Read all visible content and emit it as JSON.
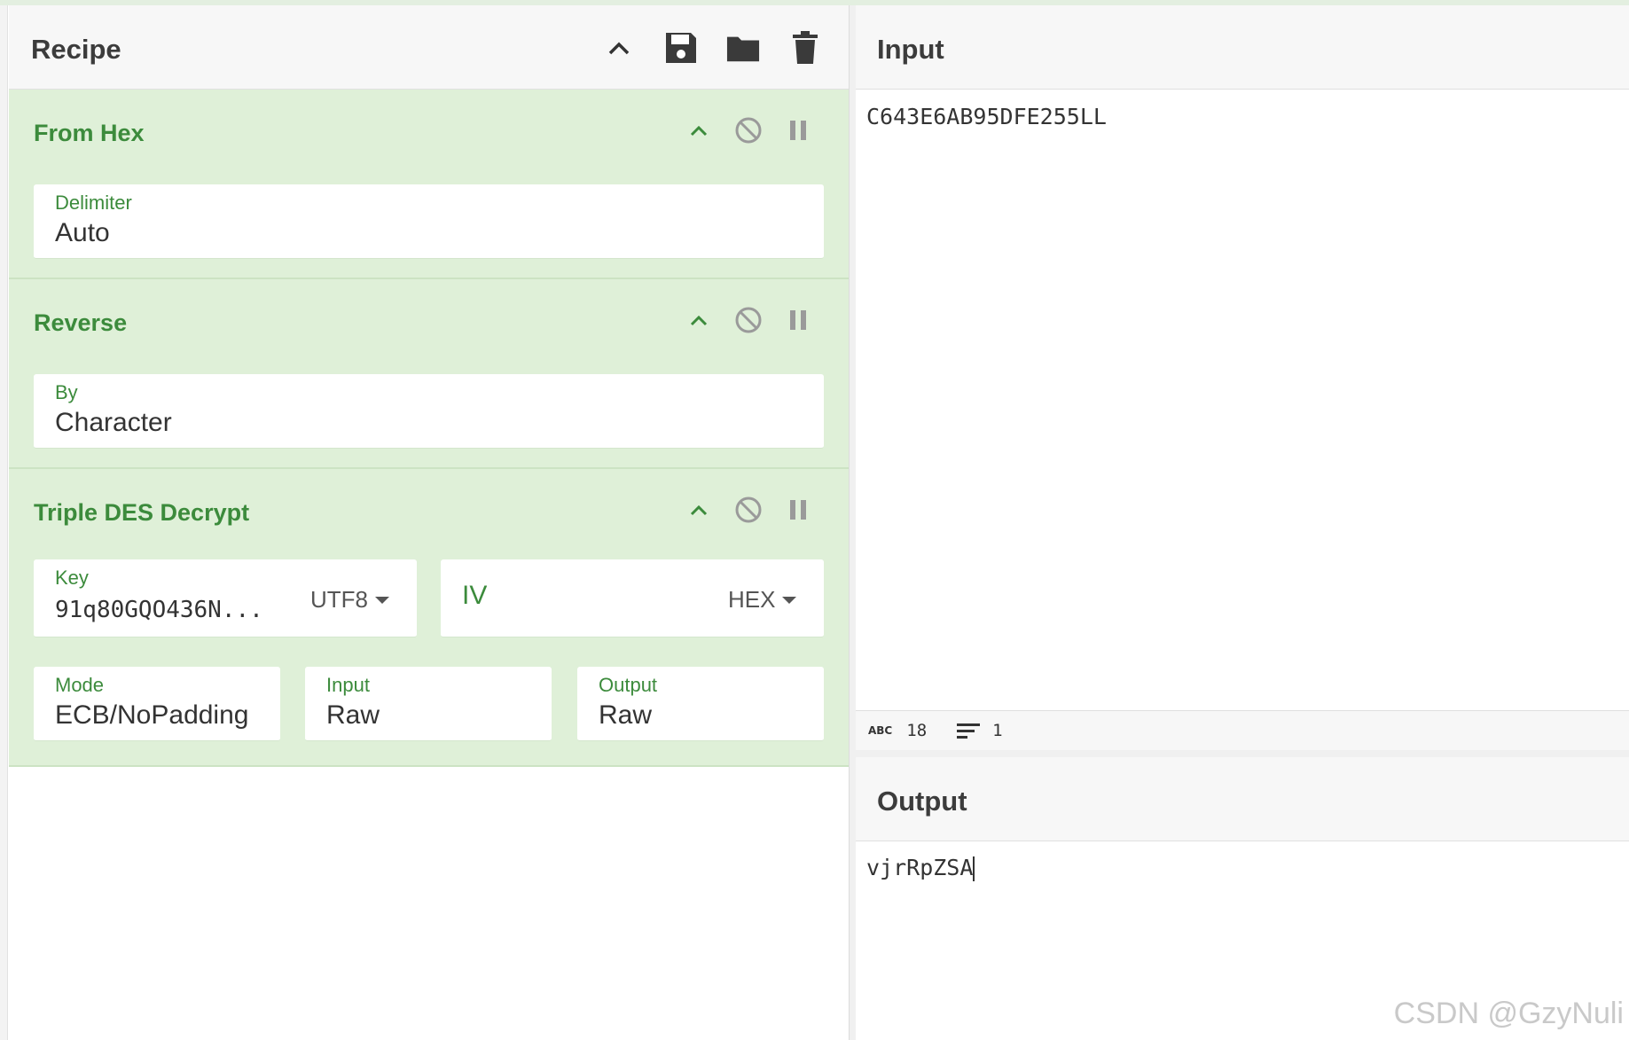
{
  "recipe": {
    "title": "Recipe",
    "operations": [
      {
        "name": "From Hex",
        "fields": [
          {
            "label": "Delimiter",
            "value": "Auto"
          }
        ]
      },
      {
        "name": "Reverse",
        "fields": [
          {
            "label": "By",
            "value": "Character"
          }
        ]
      },
      {
        "name": "Triple DES Decrypt",
        "key": {
          "label": "Key",
          "value": "91q80GQO436N...",
          "encoding": "UTF8"
        },
        "iv": {
          "label": "IV",
          "value": "",
          "encoding": "HEX"
        },
        "mode": {
          "label": "Mode",
          "value": "ECB/NoPadding"
        },
        "input": {
          "label": "Input",
          "value": "Raw"
        },
        "output": {
          "label": "Output",
          "value": "Raw"
        }
      }
    ]
  },
  "input": {
    "title": "Input",
    "text": "C643E6AB95DFE255LL",
    "status": {
      "abc_label": "ABC",
      "length": "18",
      "lines": "1"
    }
  },
  "output": {
    "title": "Output",
    "text": "vjrRpZSA"
  },
  "watermark": "CSDN @GzyNuli",
  "icons": [
    "chevron-up-icon",
    "save-icon",
    "folder-icon",
    "trash-icon",
    "disable-icon",
    "pause-icon",
    "lines-icon"
  ],
  "colors": {
    "accent": "#3c8b3c",
    "op_bg": "#dff0d8"
  }
}
